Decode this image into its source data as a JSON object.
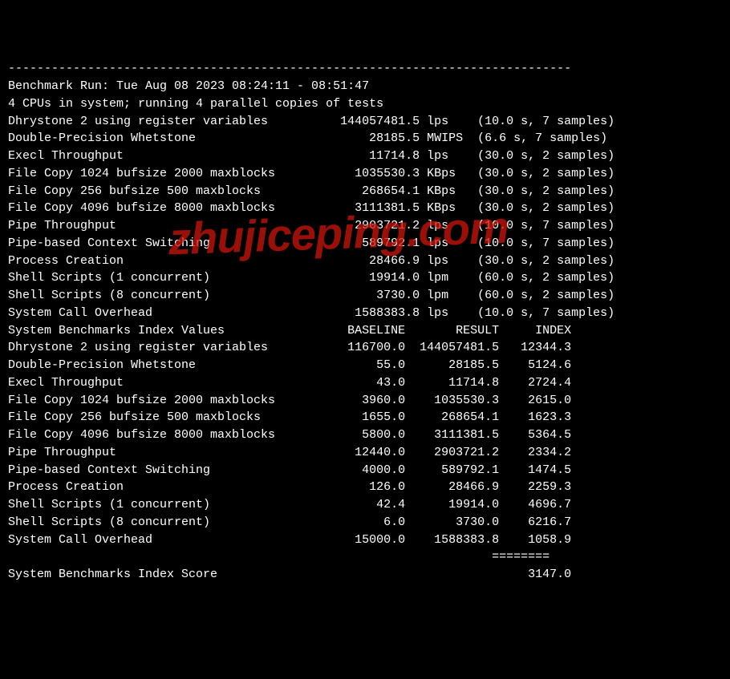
{
  "dashes": "------------------------------------------------------------------------------",
  "run_header": "Benchmark Run: Tue Aug 08 2023 08:24:11 - 08:51:47",
  "cpu_header": "4 CPUs in system; running 4 parallel copies of tests",
  "tests": [
    {
      "name": "Dhrystone 2 using register variables",
      "value": "144057481.5",
      "unit": "lps",
      "timing": "(10.0 s, 7 samples)"
    },
    {
      "name": "Double-Precision Whetstone",
      "value": "28185.5",
      "unit": "MWIPS",
      "timing": "(6.6 s, 7 samples)"
    },
    {
      "name": "Execl Throughput",
      "value": "11714.8",
      "unit": "lps",
      "timing": "(30.0 s, 2 samples)"
    },
    {
      "name": "File Copy 1024 bufsize 2000 maxblocks",
      "value": "1035530.3",
      "unit": "KBps",
      "timing": "(30.0 s, 2 samples)"
    },
    {
      "name": "File Copy 256 bufsize 500 maxblocks",
      "value": "268654.1",
      "unit": "KBps",
      "timing": "(30.0 s, 2 samples)"
    },
    {
      "name": "File Copy 4096 bufsize 8000 maxblocks",
      "value": "3111381.5",
      "unit": "KBps",
      "timing": "(30.0 s, 2 samples)"
    },
    {
      "name": "Pipe Throughput",
      "value": "2903721.2",
      "unit": "lps",
      "timing": "(10.0 s, 7 samples)"
    },
    {
      "name": "Pipe-based Context Switching",
      "value": "589792.1",
      "unit": "lps",
      "timing": "(10.0 s, 7 samples)"
    },
    {
      "name": "Process Creation",
      "value": "28466.9",
      "unit": "lps",
      "timing": "(30.0 s, 2 samples)"
    },
    {
      "name": "Shell Scripts (1 concurrent)",
      "value": "19914.0",
      "unit": "lpm",
      "timing": "(60.0 s, 2 samples)"
    },
    {
      "name": "Shell Scripts (8 concurrent)",
      "value": "3730.0",
      "unit": "lpm",
      "timing": "(60.0 s, 2 samples)"
    },
    {
      "name": "System Call Overhead",
      "value": "1588383.8",
      "unit": "lps",
      "timing": "(10.0 s, 7 samples)"
    }
  ],
  "index_header_label": "System Benchmarks Index Values",
  "index_header_baseline": "BASELINE",
  "index_header_result": "RESULT",
  "index_header_index": "INDEX",
  "index_rows": [
    {
      "name": "Dhrystone 2 using register variables",
      "baseline": "116700.0",
      "result": "144057481.5",
      "index": "12344.3"
    },
    {
      "name": "Double-Precision Whetstone",
      "baseline": "55.0",
      "result": "28185.5",
      "index": "5124.6"
    },
    {
      "name": "Execl Throughput",
      "baseline": "43.0",
      "result": "11714.8",
      "index": "2724.4"
    },
    {
      "name": "File Copy 1024 bufsize 2000 maxblocks",
      "baseline": "3960.0",
      "result": "1035530.3",
      "index": "2615.0"
    },
    {
      "name": "File Copy 256 bufsize 500 maxblocks",
      "baseline": "1655.0",
      "result": "268654.1",
      "index": "1623.3"
    },
    {
      "name": "File Copy 4096 bufsize 8000 maxblocks",
      "baseline": "5800.0",
      "result": "3111381.5",
      "index": "5364.5"
    },
    {
      "name": "Pipe Throughput",
      "baseline": "12440.0",
      "result": "2903721.2",
      "index": "2334.2"
    },
    {
      "name": "Pipe-based Context Switching",
      "baseline": "4000.0",
      "result": "589792.1",
      "index": "1474.5"
    },
    {
      "name": "Process Creation",
      "baseline": "126.0",
      "result": "28466.9",
      "index": "2259.3"
    },
    {
      "name": "Shell Scripts (1 concurrent)",
      "baseline": "42.4",
      "result": "19914.0",
      "index": "4696.7"
    },
    {
      "name": "Shell Scripts (8 concurrent)",
      "baseline": "6.0",
      "result": "3730.0",
      "index": "6216.7"
    },
    {
      "name": "System Call Overhead",
      "baseline": "15000.0",
      "result": "1588383.8",
      "index": "1058.9"
    }
  ],
  "score_separator": "                                                                   ========",
  "score_label": "System Benchmarks Index Score",
  "score_value": "3147.0",
  "watermark": "zhujiceping.com"
}
